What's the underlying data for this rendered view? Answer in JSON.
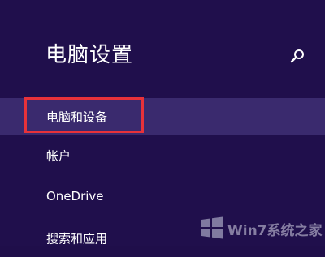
{
  "page": {
    "title": "电脑设置"
  },
  "search": {
    "icon": "search-icon"
  },
  "nav": {
    "items": [
      {
        "label": "电脑和设备",
        "selected": true
      },
      {
        "label": "帐户",
        "selected": false
      },
      {
        "label": "OneDrive",
        "selected": false
      },
      {
        "label": "搜索和应用",
        "selected": false
      }
    ]
  },
  "watermark": {
    "text": "Win7系统之家"
  },
  "colors": {
    "background": "#200f4c",
    "selected": "#3a2a6e",
    "highlight": "#e8323a",
    "text": "#ffffff"
  }
}
